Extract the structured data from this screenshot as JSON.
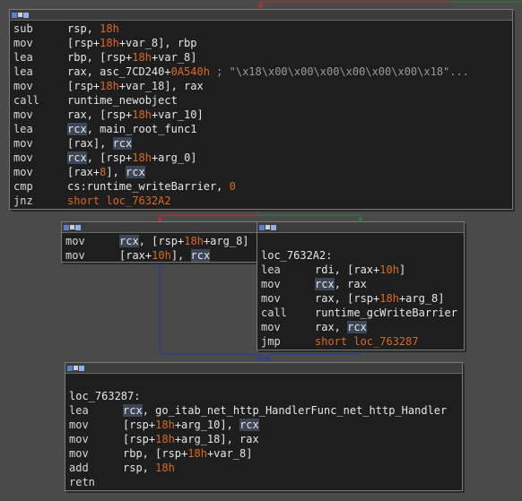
{
  "blocks": [
    {
      "id": "b1",
      "lines": [
        {
          "mn": "sub",
          "op": [
            {
              "t": "rsp, "
            },
            {
              "t": "18h",
              "c": "num"
            }
          ]
        },
        {
          "mn": "mov",
          "op": [
            {
              "t": "[rsp+"
            },
            {
              "t": "18h",
              "c": "num"
            },
            {
              "t": "+var_8], rbp"
            }
          ]
        },
        {
          "mn": "lea",
          "op": [
            {
              "t": "rbp, [rsp+"
            },
            {
              "t": "18h",
              "c": "num"
            },
            {
              "t": "+var_8]"
            }
          ]
        },
        {
          "mn": "lea",
          "op": [
            {
              "t": "rax, asc_7CD240+"
            },
            {
              "t": "0A540h",
              "c": "num"
            },
            {
              "t": " ; \"\\x18\\x00\\x00\\x00\\x00\\x00\\x00\\x18\"...",
              "c": "cm"
            }
          ]
        },
        {
          "mn": "mov",
          "op": [
            {
              "t": "[rsp+"
            },
            {
              "t": "18h",
              "c": "num"
            },
            {
              "t": "+var_18], rax"
            }
          ]
        },
        {
          "mn": "call",
          "op": [
            {
              "t": "runtime_newobject"
            }
          ]
        },
        {
          "mn": "mov",
          "op": [
            {
              "t": "rax, [rsp+"
            },
            {
              "t": "18h",
              "c": "num"
            },
            {
              "t": "+var_10]"
            }
          ]
        },
        {
          "mn": "lea",
          "op": [
            {
              "t": "rcx",
              "c": "reg-hl"
            },
            {
              "t": ", main_root_func1"
            }
          ]
        },
        {
          "mn": "mov",
          "op": [
            {
              "t": "[rax], "
            },
            {
              "t": "rcx",
              "c": "reg-hl"
            }
          ]
        },
        {
          "mn": "mov",
          "op": [
            {
              "t": "rcx",
              "c": "reg-hl"
            },
            {
              "t": ", [rsp+"
            },
            {
              "t": "18h",
              "c": "num"
            },
            {
              "t": "+arg_0]"
            }
          ]
        },
        {
          "mn": "mov",
          "op": [
            {
              "t": "[rax+"
            },
            {
              "t": "8",
              "c": "num"
            },
            {
              "t": "], "
            },
            {
              "t": "rcx",
              "c": "reg-hl"
            }
          ]
        },
        {
          "mn": "cmp",
          "op": [
            {
              "t": "cs:runtime_writeBarrier, "
            },
            {
              "t": "0",
              "c": "num"
            }
          ]
        },
        {
          "mn": "jnz",
          "op": [
            {
              "t": "short loc_7632A2",
              "c": "num"
            }
          ]
        }
      ]
    },
    {
      "id": "b2",
      "lines": [
        {
          "mn": "mov",
          "op": [
            {
              "t": "rcx",
              "c": "reg-hl"
            },
            {
              "t": ", [rsp+"
            },
            {
              "t": "18h",
              "c": "num"
            },
            {
              "t": "+arg_8]"
            }
          ]
        },
        {
          "mn": "mov",
          "op": [
            {
              "t": "[rax+"
            },
            {
              "t": "10h",
              "c": "num"
            },
            {
              "t": "], "
            },
            {
              "t": "rcx",
              "c": "reg-hl"
            }
          ]
        }
      ]
    },
    {
      "id": "b3",
      "label": "loc_7632A2:",
      "lines": [
        {
          "mn": "lea",
          "op": [
            {
              "t": "rdi, [rax+"
            },
            {
              "t": "10h",
              "c": "num"
            },
            {
              "t": "]"
            }
          ]
        },
        {
          "mn": "mov",
          "op": [
            {
              "t": "rcx",
              "c": "reg-hl"
            },
            {
              "t": ", rax"
            }
          ]
        },
        {
          "mn": "mov",
          "op": [
            {
              "t": "rax, [rsp+"
            },
            {
              "t": "18h",
              "c": "num"
            },
            {
              "t": "+arg_8]"
            }
          ]
        },
        {
          "mn": "call",
          "op": [
            {
              "t": "runtime_gcWriteBarrier"
            }
          ]
        },
        {
          "mn": "mov",
          "op": [
            {
              "t": "rax, "
            },
            {
              "t": "rcx",
              "c": "reg-hl"
            }
          ]
        },
        {
          "mn": "jmp",
          "op": [
            {
              "t": "short loc_763287",
              "c": "num"
            }
          ]
        }
      ]
    },
    {
      "id": "b4",
      "label": "loc_763287:",
      "lines": [
        {
          "mn": "lea",
          "op": [
            {
              "t": "rcx",
              "c": "reg-hl"
            },
            {
              "t": ", go_itab_net_http_HandlerFunc_net_http_Handler"
            }
          ]
        },
        {
          "mn": "mov",
          "op": [
            {
              "t": "[rsp+"
            },
            {
              "t": "18h",
              "c": "num"
            },
            {
              "t": "+arg_10], "
            },
            {
              "t": "rcx",
              "c": "reg-hl"
            }
          ]
        },
        {
          "mn": "mov",
          "op": [
            {
              "t": "[rsp+"
            },
            {
              "t": "18h",
              "c": "num"
            },
            {
              "t": "+arg_18], rax"
            }
          ]
        },
        {
          "mn": "mov",
          "op": [
            {
              "t": "rbp, [rsp+"
            },
            {
              "t": "18h",
              "c": "num"
            },
            {
              "t": "+var_8]"
            }
          ]
        },
        {
          "mn": "add",
          "op": [
            {
              "t": "rsp, "
            },
            {
              "t": "18h",
              "c": "num"
            }
          ]
        },
        {
          "mn": "retn",
          "op": []
        }
      ]
    }
  ],
  "colors": {
    "edge_true": "#2e7d32",
    "edge_false": "#c62828",
    "edge_uncond": "#1e3fa8"
  }
}
